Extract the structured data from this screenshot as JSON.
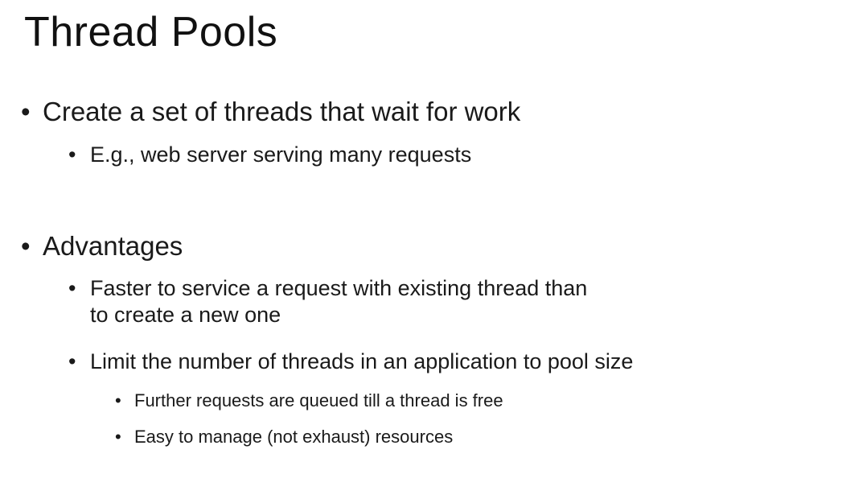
{
  "slide": {
    "title": "Thread Pools",
    "bullet_glyph": "•",
    "items": [
      {
        "text": "Create a set of threads that wait for work"
      },
      {
        "text": "E.g., web server serving many requests"
      },
      {
        "text": "Advantages"
      },
      {
        "text_line1": "Faster to service a request with existing thread than",
        "text_line2": "to create a new one"
      },
      {
        "text": "Limit the number of threads in an application to pool size"
      },
      {
        "text": "Further requests are queued till a thread is free"
      },
      {
        "text": "Easy to manage (not exhaust) resources"
      }
    ]
  }
}
